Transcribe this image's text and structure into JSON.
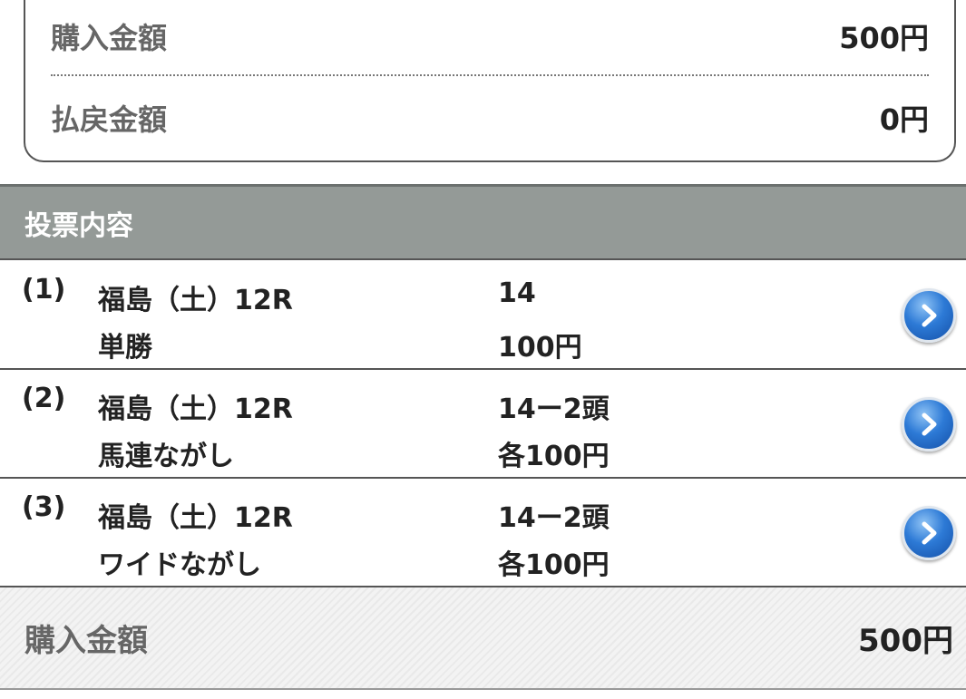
{
  "summary": {
    "purchase_label": "購入金額",
    "purchase_value": "500円",
    "refund_label": "払戻金額",
    "refund_value": "0円"
  },
  "section": {
    "title": "投票内容"
  },
  "bets": [
    {
      "index": "(1)",
      "race": "福島（土）12R",
      "type": "単勝",
      "horse": "14",
      "amount": "100円",
      "icon": "chevron-right-icon"
    },
    {
      "index": "(2)",
      "race": "福島（土）12R",
      "type": "馬連ながし",
      "horse": "14ー2頭",
      "amount": "各100円",
      "icon": "chevron-right-icon"
    },
    {
      "index": "(3)",
      "race": "福島（土）12R",
      "type": "ワイドながし",
      "horse": "14ー2頭",
      "amount": "各100円",
      "icon": "chevron-right-icon"
    }
  ],
  "total": {
    "label": "購入金額",
    "value": "500円"
  },
  "colors": {
    "header_bg": "#949a97",
    "button_blue": "#2d7ad6"
  }
}
